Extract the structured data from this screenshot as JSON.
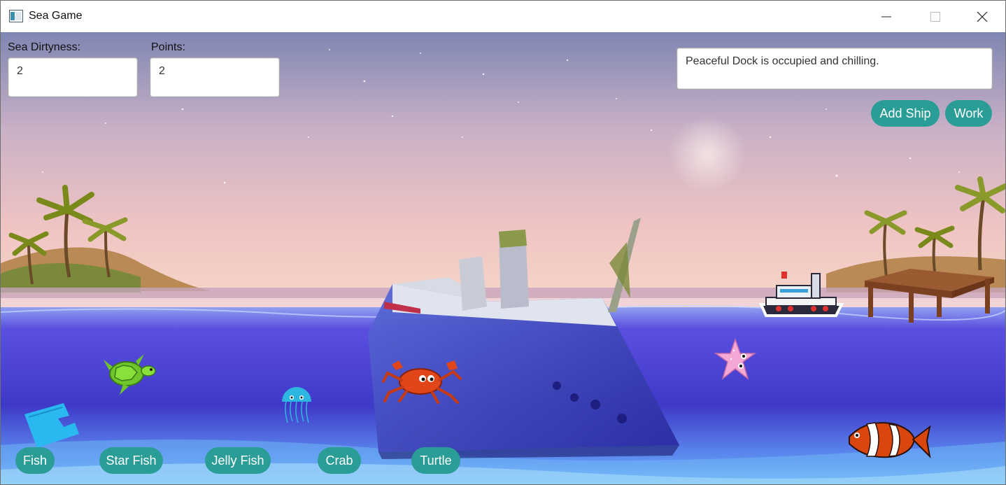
{
  "window": {
    "title": "Sea Game",
    "app_icon": "javafx-window-icon",
    "controls": [
      "minimize-icon",
      "maximize-icon",
      "close-icon"
    ]
  },
  "stats": {
    "dirtiness_label": "Sea Dirtyness:",
    "dirtiness_value": "2",
    "points_label": "Points:",
    "points_value": "2"
  },
  "message": {
    "text": "Peaceful Dock is occupied and chilling."
  },
  "actions": {
    "add_ship": "Add Ship",
    "work": "Work"
  },
  "creature_buttons": {
    "fish": "Fish",
    "star_fish": "Star Fish",
    "jelly_fish": "Jelly Fish",
    "crab": "Crab",
    "turtle": "Turtle"
  },
  "sprites": [
    "turtle-sprite",
    "jellyfish-sprite",
    "crab-sprite",
    "starfish-sprite",
    "clownfish-sprite",
    "ship-sprite",
    "plastic-bag-trash",
    "sunken-ship",
    "wooden-dock",
    "moon",
    "palm-trees"
  ],
  "colors": {
    "button": "#2a9d96",
    "sky_top": "#8a8fb8",
    "sky_bottom": "#f1c9c4",
    "sea": "#4a3fd0"
  }
}
